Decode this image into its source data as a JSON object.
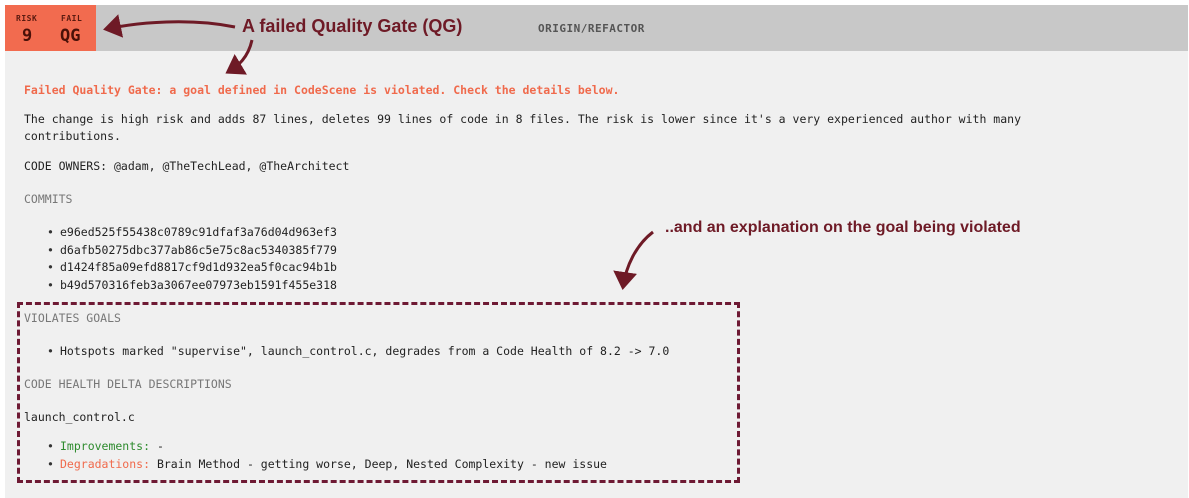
{
  "badge": {
    "risk_label": "RISK",
    "risk_value": "9",
    "fail_label": "FAIL",
    "fail_value": "QG"
  },
  "header": {
    "branch": "ORIGIN/REFACTOR"
  },
  "annotations": {
    "top": "A failed Quality Gate (QG)",
    "middle": "..and an explanation on the goal being violated"
  },
  "report": {
    "warning": "Failed Quality Gate: a goal defined in CodeScene is violated. Check the details below.",
    "summary_line1": "The change is high risk and adds 87 lines, deletes 99 lines of code in 8 files. The risk is lower since it's a very experienced author with many",
    "summary_line2": "contributions.",
    "code_owners": "CODE OWNERS: @adam, @TheTechLead, @TheArchitect",
    "commits_heading": "COMMITS",
    "commits": [
      "e96ed525f55438c0789c91dfaf3a76d04d963ef3",
      "d6afb50275dbc377ab86c5e75c8ac5340385f779",
      "d1424f85a09efd8817cf9d1d932ea5f0cac94b1b",
      "b49d570316feb3a3067ee07973eb1591f455e318"
    ],
    "violates_heading": "VIOLATES GOALS",
    "violation": "Hotspots marked \"supervise\", launch_control.c, degrades from a Code Health of 8.2 -> 7.0",
    "delta_heading": "CODE HEALTH DELTA DESCRIPTIONS",
    "file_name": "launch_control.c",
    "improvements_label": "Improvements:",
    "improvements_value": " -",
    "degradations_label": "Degradations:",
    "degradations_value": " Brain Method - getting worse, Deep, Nested Complexity - new issue"
  },
  "colors": {
    "risk_badge": "#f26b4f",
    "header_bg": "#c8c8c8",
    "panel_bg": "#f0f0f0",
    "annotation": "#6e1a26",
    "warning_text": "#f06a4c",
    "improvement": "#2e8b2e"
  }
}
